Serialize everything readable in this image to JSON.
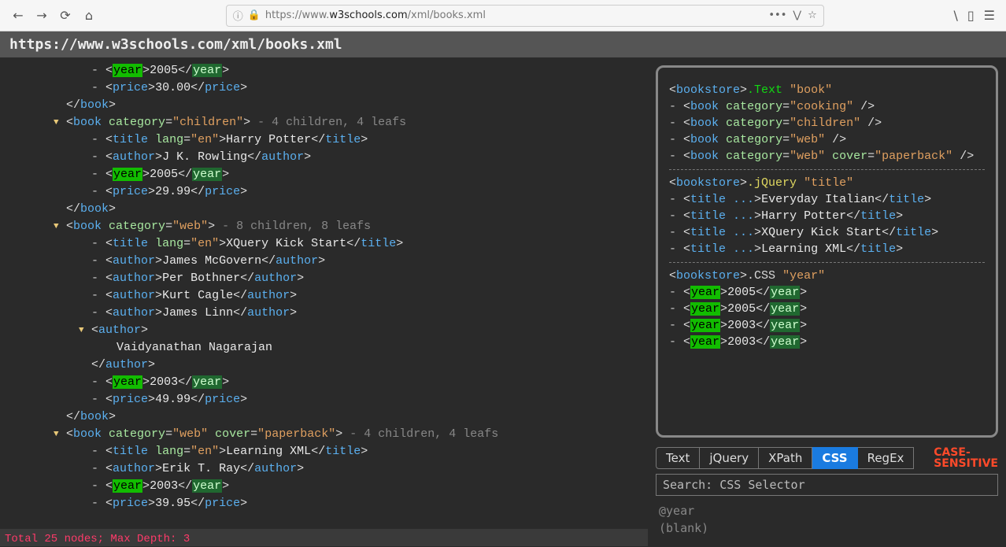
{
  "browser": {
    "url_proto": "https://",
    "url_pre": "www.",
    "url_host": "w3schools.com",
    "url_path": "/xml/books.xml"
  },
  "title_bar": "https://www.w3schools.com/xml/books.xml",
  "tree": {
    "book0": {
      "year": "2005",
      "price": "30.00"
    },
    "book1": {
      "category": "children",
      "summary": "- 4 children, 4 leafs",
      "title_lang": "en",
      "title": "Harry Potter",
      "author": "J K. Rowling",
      "year": "2005",
      "price": "29.99"
    },
    "book2": {
      "category": "web",
      "summary": "- 8 children, 8 leafs",
      "title_lang": "en",
      "title": "XQuery Kick Start",
      "authors": [
        "James McGovern",
        "Per Bothner",
        "Kurt Cagle",
        "James Linn",
        "Vaidyanathan Nagarajan"
      ],
      "year": "2003",
      "price": "49.99"
    },
    "book3": {
      "category": "web",
      "cover": "paperback",
      "summary": "- 4 children, 4 leafs",
      "title_lang": "en",
      "title": "Learning XML",
      "author": "Erik T. Ray",
      "year": "2003",
      "price": "39.95"
    }
  },
  "results": {
    "text": {
      "root": "bookstore",
      "label": ".Text",
      "query": "book",
      "lines": [
        {
          "attrs": "category=\"cooking\""
        },
        {
          "attrs": "category=\"children\""
        },
        {
          "attrs": "category=\"web\""
        },
        {
          "attrs": "category=\"web\" cover=\"paperback\""
        }
      ]
    },
    "jquery": {
      "root": "bookstore",
      "label": ".jQuery",
      "query": "title",
      "titles": [
        "Everyday Italian",
        "Harry Potter",
        "XQuery Kick Start",
        "Learning XML"
      ]
    },
    "css": {
      "root": "bookstore",
      "label": ".CSS",
      "query": "year",
      "years": [
        "2005",
        "2005",
        "2003",
        "2003"
      ]
    }
  },
  "tabs": [
    "Text",
    "jQuery",
    "XPath",
    "CSS",
    "RegEx"
  ],
  "active_tab": "CSS",
  "case_sensitive": "CASE-\nSENSITIVE",
  "search_placeholder": "Search: CSS Selector",
  "history": [
    "@year",
    "(blank)"
  ],
  "status": "Total 25 nodes; Max Depth: 3"
}
